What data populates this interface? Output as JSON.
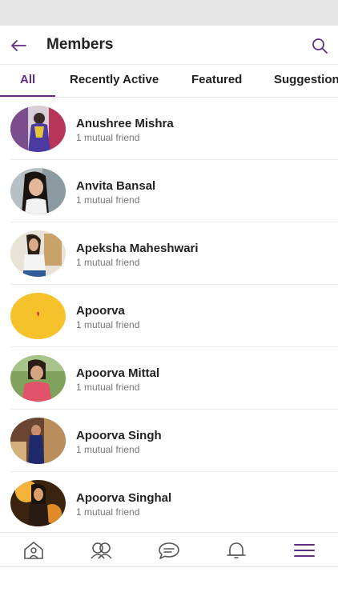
{
  "header": {
    "title": "Members"
  },
  "tabs": [
    {
      "label": "All"
    },
    {
      "label": "Recently Active"
    },
    {
      "label": "Featured"
    },
    {
      "label": "Suggestions"
    }
  ],
  "members": [
    {
      "name": "Anushree Mishra",
      "subtitle": "1 mutual friend"
    },
    {
      "name": "Anvita Bansal",
      "subtitle": "1 mutual friend"
    },
    {
      "name": "Apeksha Maheshwari",
      "subtitle": "1 mutual friend"
    },
    {
      "name": "Apoorva",
      "subtitle": "1 mutual friend"
    },
    {
      "name": "Apoorva Mittal",
      "subtitle": "1 mutual friend"
    },
    {
      "name": "Apoorva Singh",
      "subtitle": "1 mutual friend"
    },
    {
      "name": "Apoorva Singhal",
      "subtitle": "1 mutual friend"
    }
  ],
  "bottom_nav": [
    {
      "icon": "home-icon"
    },
    {
      "icon": "groups-icon"
    },
    {
      "icon": "chat-icon"
    },
    {
      "icon": "bell-icon"
    },
    {
      "icon": "menu-icon"
    }
  ],
  "colors": {
    "accent": "#5f2c82",
    "status_bar": "#e6e6e6"
  }
}
